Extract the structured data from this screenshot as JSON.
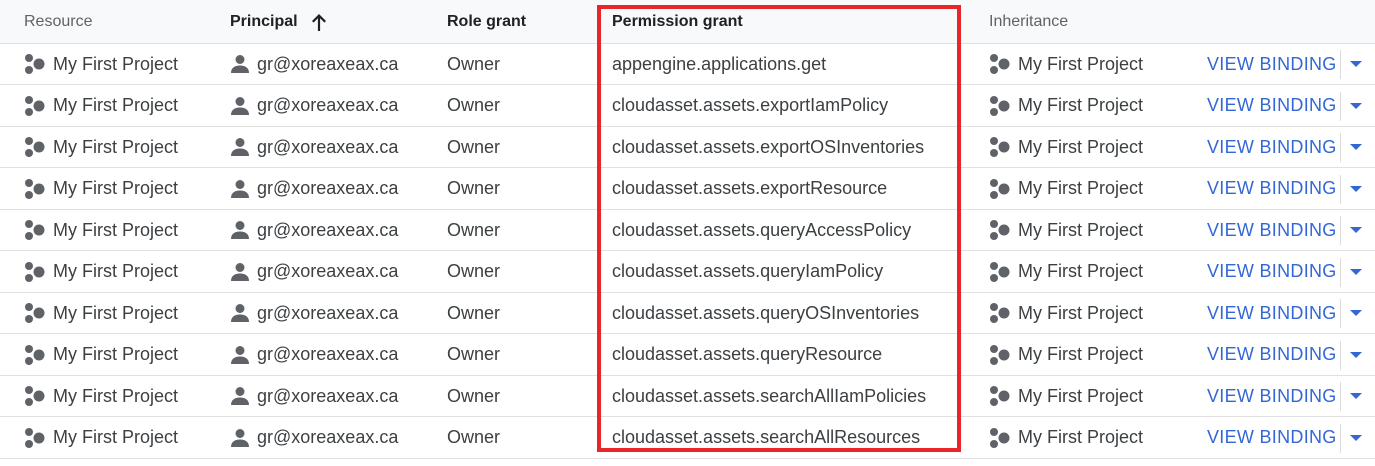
{
  "columns": {
    "resource": "Resource",
    "principal": "Principal",
    "role_grant": "Role grant",
    "permission_grant": "Permission grant",
    "inheritance": "Inheritance"
  },
  "sort": {
    "column": "Principal",
    "direction": "ascending",
    "icon": "arrow-up-icon"
  },
  "rows": [
    {
      "resource": "My First Project",
      "principal": "gr@xoreaxeax.ca",
      "role": "Owner",
      "permission": "appengine.applications.get",
      "inheritance": "My First Project",
      "action": "VIEW BINDING"
    },
    {
      "resource": "My First Project",
      "principal": "gr@xoreaxeax.ca",
      "role": "Owner",
      "permission": "cloudasset.assets.exportIamPolicy",
      "inheritance": "My First Project",
      "action": "VIEW BINDING"
    },
    {
      "resource": "My First Project",
      "principal": "gr@xoreaxeax.ca",
      "role": "Owner",
      "permission": "cloudasset.assets.exportOSInventories",
      "inheritance": "My First Project",
      "action": "VIEW BINDING"
    },
    {
      "resource": "My First Project",
      "principal": "gr@xoreaxeax.ca",
      "role": "Owner",
      "permission": "cloudasset.assets.exportResource",
      "inheritance": "My First Project",
      "action": "VIEW BINDING"
    },
    {
      "resource": "My First Project",
      "principal": "gr@xoreaxeax.ca",
      "role": "Owner",
      "permission": "cloudasset.assets.queryAccessPolicy",
      "inheritance": "My First Project",
      "action": "VIEW BINDING"
    },
    {
      "resource": "My First Project",
      "principal": "gr@xoreaxeax.ca",
      "role": "Owner",
      "permission": "cloudasset.assets.queryIamPolicy",
      "inheritance": "My First Project",
      "action": "VIEW BINDING"
    },
    {
      "resource": "My First Project",
      "principal": "gr@xoreaxeax.ca",
      "role": "Owner",
      "permission": "cloudasset.assets.queryOSInventories",
      "inheritance": "My First Project",
      "action": "VIEW BINDING"
    },
    {
      "resource": "My First Project",
      "principal": "gr@xoreaxeax.ca",
      "role": "Owner",
      "permission": "cloudasset.assets.queryResource",
      "inheritance": "My First Project",
      "action": "VIEW BINDING"
    },
    {
      "resource": "My First Project",
      "principal": "gr@xoreaxeax.ca",
      "role": "Owner",
      "permission": "cloudasset.assets.searchAllIamPolicies",
      "inheritance": "My First Project",
      "action": "VIEW BINDING"
    },
    {
      "resource": "My First Project",
      "principal": "gr@xoreaxeax.ca",
      "role": "Owner",
      "permission": "cloudasset.assets.searchAllResources",
      "inheritance": "My First Project",
      "action": "VIEW BINDING"
    }
  ],
  "icons": {
    "resource": "project-icon",
    "principal": "person-icon",
    "dropdown": "chevron-down-icon"
  },
  "colors": {
    "accent": "#3367d6",
    "highlight": "#e8262a",
    "header_bg": "#f8f9fa"
  }
}
